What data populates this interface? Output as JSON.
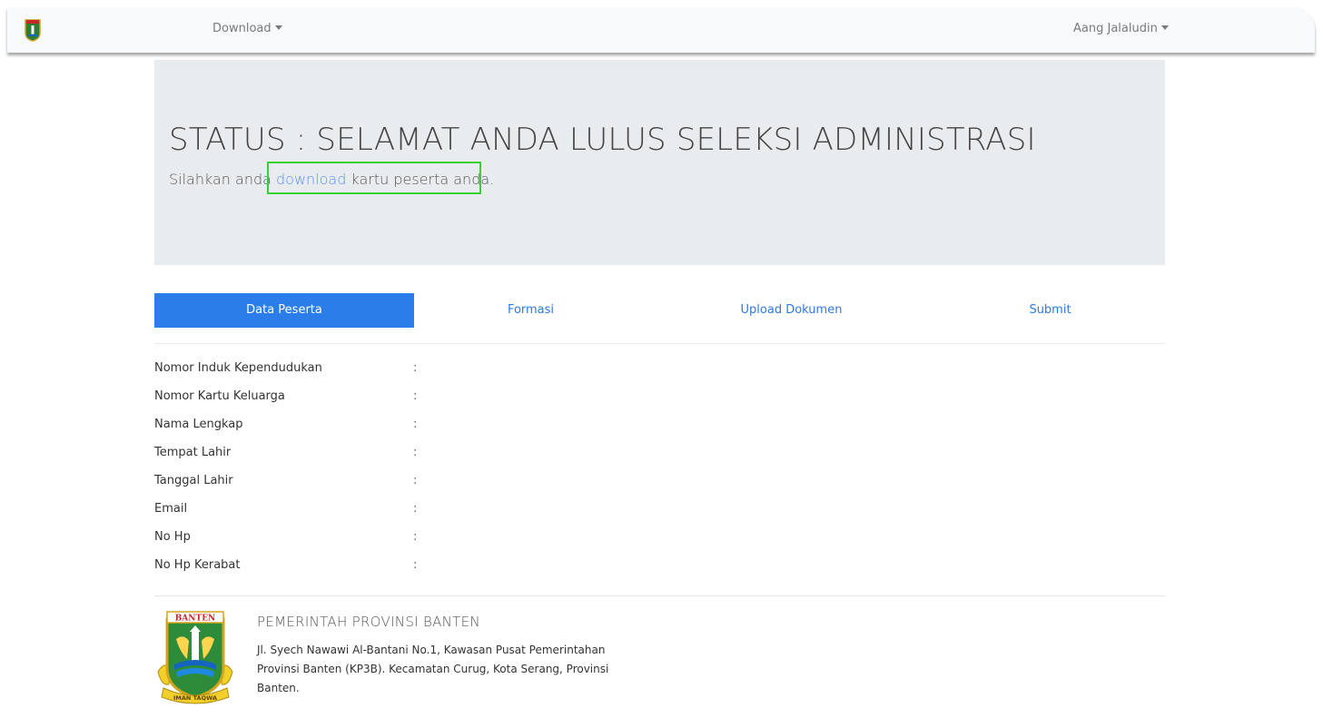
{
  "navbar": {
    "download_label": "Download",
    "user_label": "Aang Jalaludin"
  },
  "status": {
    "title": "STATUS : SELAMAT ANDA LULUS SELEKSI ADMINISTRASI",
    "sub_before": "Silahkan anda ",
    "download_link": "download",
    "sub_after": " kartu peserta anda."
  },
  "tabs": [
    {
      "label": "Data Peserta",
      "active": true
    },
    {
      "label": "Formasi",
      "active": false
    },
    {
      "label": "Upload Dokumen",
      "active": false
    },
    {
      "label": "Submit",
      "active": false
    }
  ],
  "fields": [
    {
      "label": "Nomor Induk Kependudukan",
      "sep": ":",
      "value": ""
    },
    {
      "label": "Nomor Kartu Keluarga",
      "sep": ":",
      "value": ""
    },
    {
      "label": "Nama Lengkap",
      "sep": ":",
      "value": ""
    },
    {
      "label": "Tempat Lahir",
      "sep": ":",
      "value": ""
    },
    {
      "label": "Tanggal Lahir",
      "sep": ":",
      "value": ""
    },
    {
      "label": "Email",
      "sep": ":",
      "value": ""
    },
    {
      "label": "No Hp",
      "sep": ":",
      "value": ""
    },
    {
      "label": "No Hp Kerabat",
      "sep": ":",
      "value": ""
    }
  ],
  "footer": {
    "logo_text_top": "BANTEN",
    "logo_text_bottom": "IMAN TAQWA",
    "title": "PEMERINTAH PROVINSI BANTEN",
    "address": "Jl. Syech Nawawi Al-Bantani No.1, Kawasan Pusat Pemerintahan Provinsi Banten (KP3B). Kecamatan Curug, Kota Serang, Provinsi Banten."
  },
  "colors": {
    "accent": "#2b7de9",
    "link": "#5c8ff0",
    "highlight": "#35d135",
    "jumbotron_bg": "#e9ecef"
  }
}
